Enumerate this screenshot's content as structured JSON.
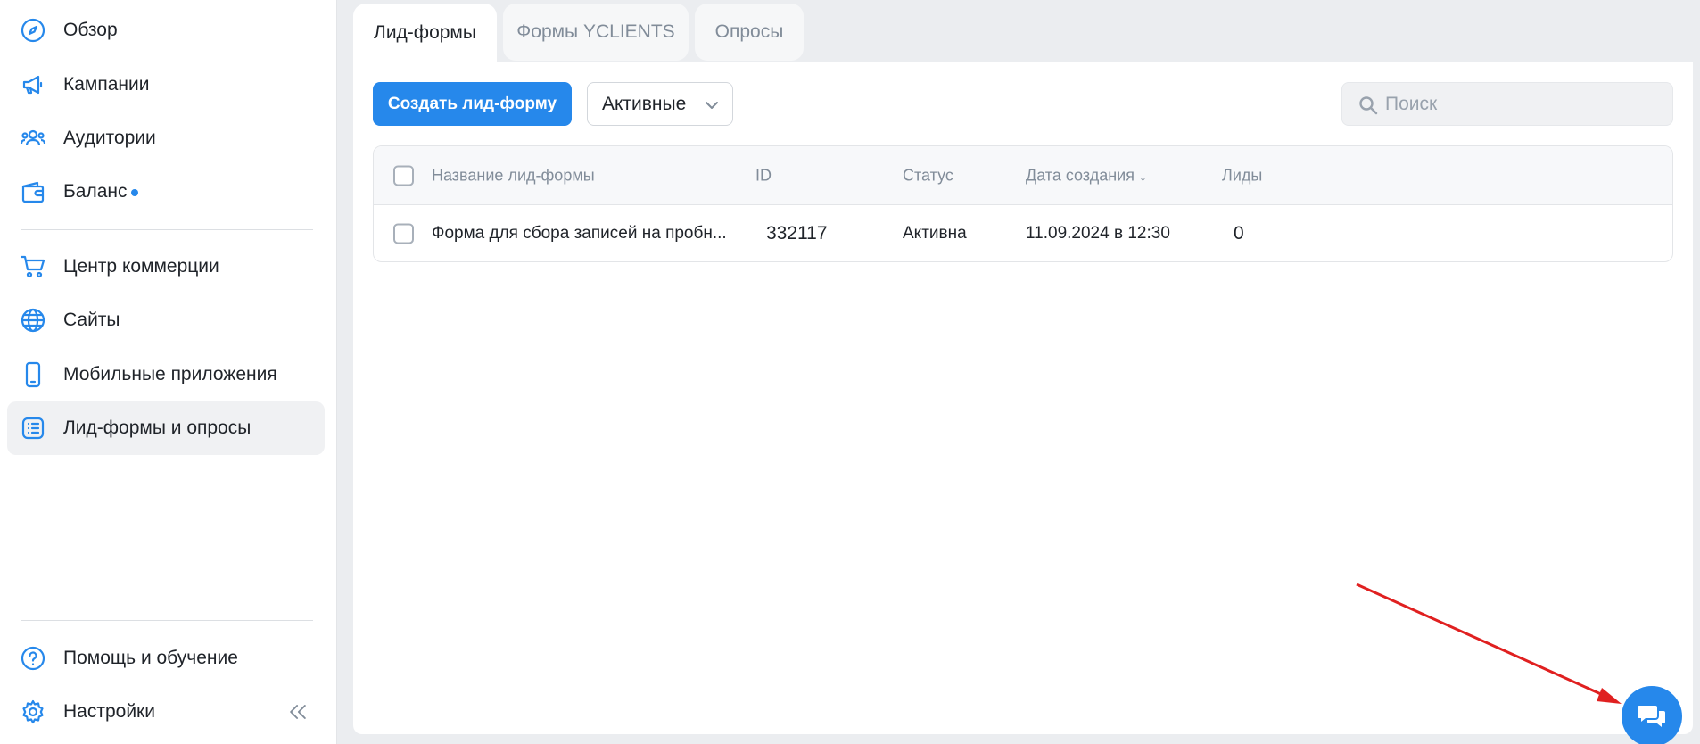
{
  "sidebar": {
    "items": [
      {
        "label": "Обзор",
        "icon": "compass-icon"
      },
      {
        "label": "Кампании",
        "icon": "megaphone-icon"
      },
      {
        "label": "Аудитории",
        "icon": "users-icon"
      },
      {
        "label": "Баланс",
        "icon": "wallet-icon",
        "badge": "dot"
      },
      {
        "label": "Центр коммерции",
        "icon": "cart-icon"
      },
      {
        "label": "Сайты",
        "icon": "globe-icon"
      },
      {
        "label": "Мобильные приложения",
        "icon": "phone-icon"
      },
      {
        "label": "Лид-формы и опросы",
        "icon": "list-icon",
        "active": true
      }
    ],
    "bottom_items": [
      {
        "label": "Помощь и обучение",
        "icon": "help-icon"
      },
      {
        "label": "Настройки",
        "icon": "gear-icon"
      }
    ]
  },
  "tabs": [
    {
      "label": "Лид-формы",
      "active": true
    },
    {
      "label": "Формы YCLIENTS",
      "active": false
    },
    {
      "label": "Опросы",
      "active": false
    }
  ],
  "toolbar": {
    "create_label": "Создать лид-форму",
    "filter_value": "Активные",
    "search_placeholder": "Поиск"
  },
  "table": {
    "columns": [
      "Название лид-формы",
      "ID",
      "Статус",
      "Дата создания ↓",
      "Лиды"
    ],
    "rows": [
      {
        "name": "Форма для сбора записей на пробн...",
        "id": "332117",
        "status": "Активна",
        "created": "11.09.2024 в 12:30",
        "leads": "0"
      }
    ]
  },
  "colors": {
    "accent": "#2688eb",
    "annotation_arrow": "#e02020"
  }
}
